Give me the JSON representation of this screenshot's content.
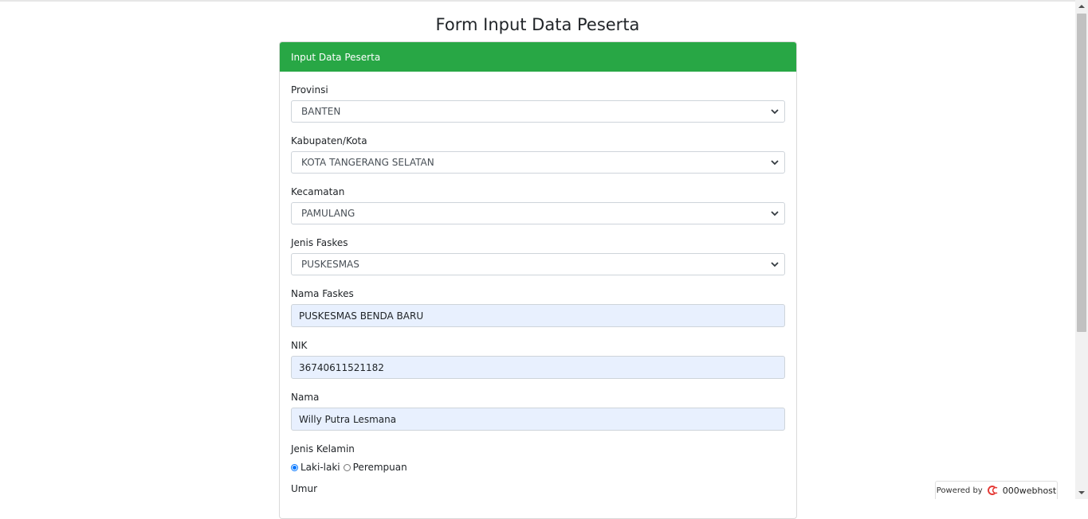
{
  "page": {
    "title": "Form Input Data Peserta"
  },
  "card": {
    "header": "Input Data Peserta"
  },
  "form": {
    "provinsi": {
      "label": "Provinsi",
      "value": "BANTEN"
    },
    "kabupaten": {
      "label": "Kabupaten/Kota",
      "value": "KOTA TANGERANG SELATAN"
    },
    "kecamatan": {
      "label": "Kecamatan",
      "value": "PAMULANG"
    },
    "jenis_faskes": {
      "label": "Jenis Faskes",
      "value": "PUSKESMAS"
    },
    "nama_faskes": {
      "label": "Nama Faskes",
      "value": "PUSKESMAS BENDA BARU"
    },
    "nik": {
      "label": "NIK",
      "value": "36740611521182"
    },
    "nama": {
      "label": "Nama",
      "value": "Willy Putra Lesmana"
    },
    "jenis_kelamin": {
      "label": "Jenis Kelamin",
      "options": [
        "Laki-laki",
        "Perempuan"
      ],
      "selected": "Laki-laki"
    },
    "umur": {
      "label": "Umur"
    }
  },
  "footer": {
    "powered_by": "Powered by",
    "brand": "000webhost"
  },
  "colors": {
    "header_green": "#28a745",
    "autofill_bg": "#e8f0fe",
    "radio_accent": "#0075ff",
    "brand_red": "#e53935"
  },
  "icons": [
    "chevron-down-icon",
    "webhost-logo-icon",
    "scroll-up-arrow-icon",
    "scroll-down-arrow-icon"
  ]
}
